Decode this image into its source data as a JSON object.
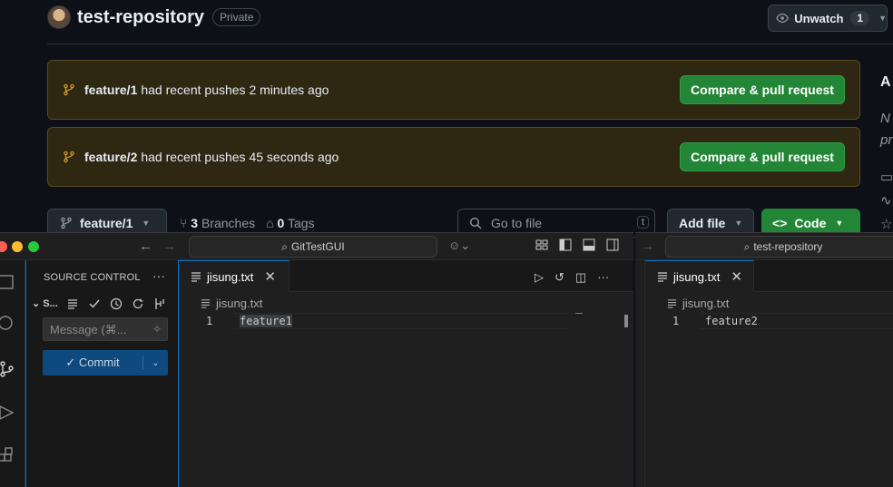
{
  "github": {
    "repo_name": "test-repository",
    "visibility": "Private",
    "unwatch_label": "Unwatch",
    "watch_count": "1",
    "banners": [
      {
        "branch": "feature/1",
        "message": "had recent pushes 2 minutes ago",
        "button": "Compare & pull request"
      },
      {
        "branch": "feature/2",
        "message": "had recent pushes 45 seconds ago",
        "button": "Compare & pull request"
      }
    ],
    "side_partial": {
      "a": "A",
      "n": "N",
      "p": "pr"
    },
    "toolbar": {
      "branch": "feature/1",
      "branches_count": "3",
      "branches_label": "Branches",
      "tags_count": "0",
      "tags_label": "Tags",
      "goto_placeholder": "Go to file",
      "goto_key": "t",
      "add_file": "Add file",
      "code": "Code"
    },
    "colors": {
      "accent_green": "#238636",
      "banner_bg": "#2e2712",
      "banner_icon": "#d29922"
    }
  },
  "vscode1": {
    "search_title": "GitTestGUI",
    "sidebar_title": "SOURCE CONTROL",
    "section_label": "S...",
    "message_placeholder": "Message (⌘...",
    "commit_label": "Commit",
    "tab_name": "jisung.txt",
    "breadcrumb": "jisung.txt",
    "line_number": "1",
    "line_text": "feature1"
  },
  "vscode2": {
    "search_title": "test-repository",
    "tab_name": "jisung.txt",
    "breadcrumb": "jisung.txt",
    "line_number": "1",
    "line_text": "feature2"
  }
}
